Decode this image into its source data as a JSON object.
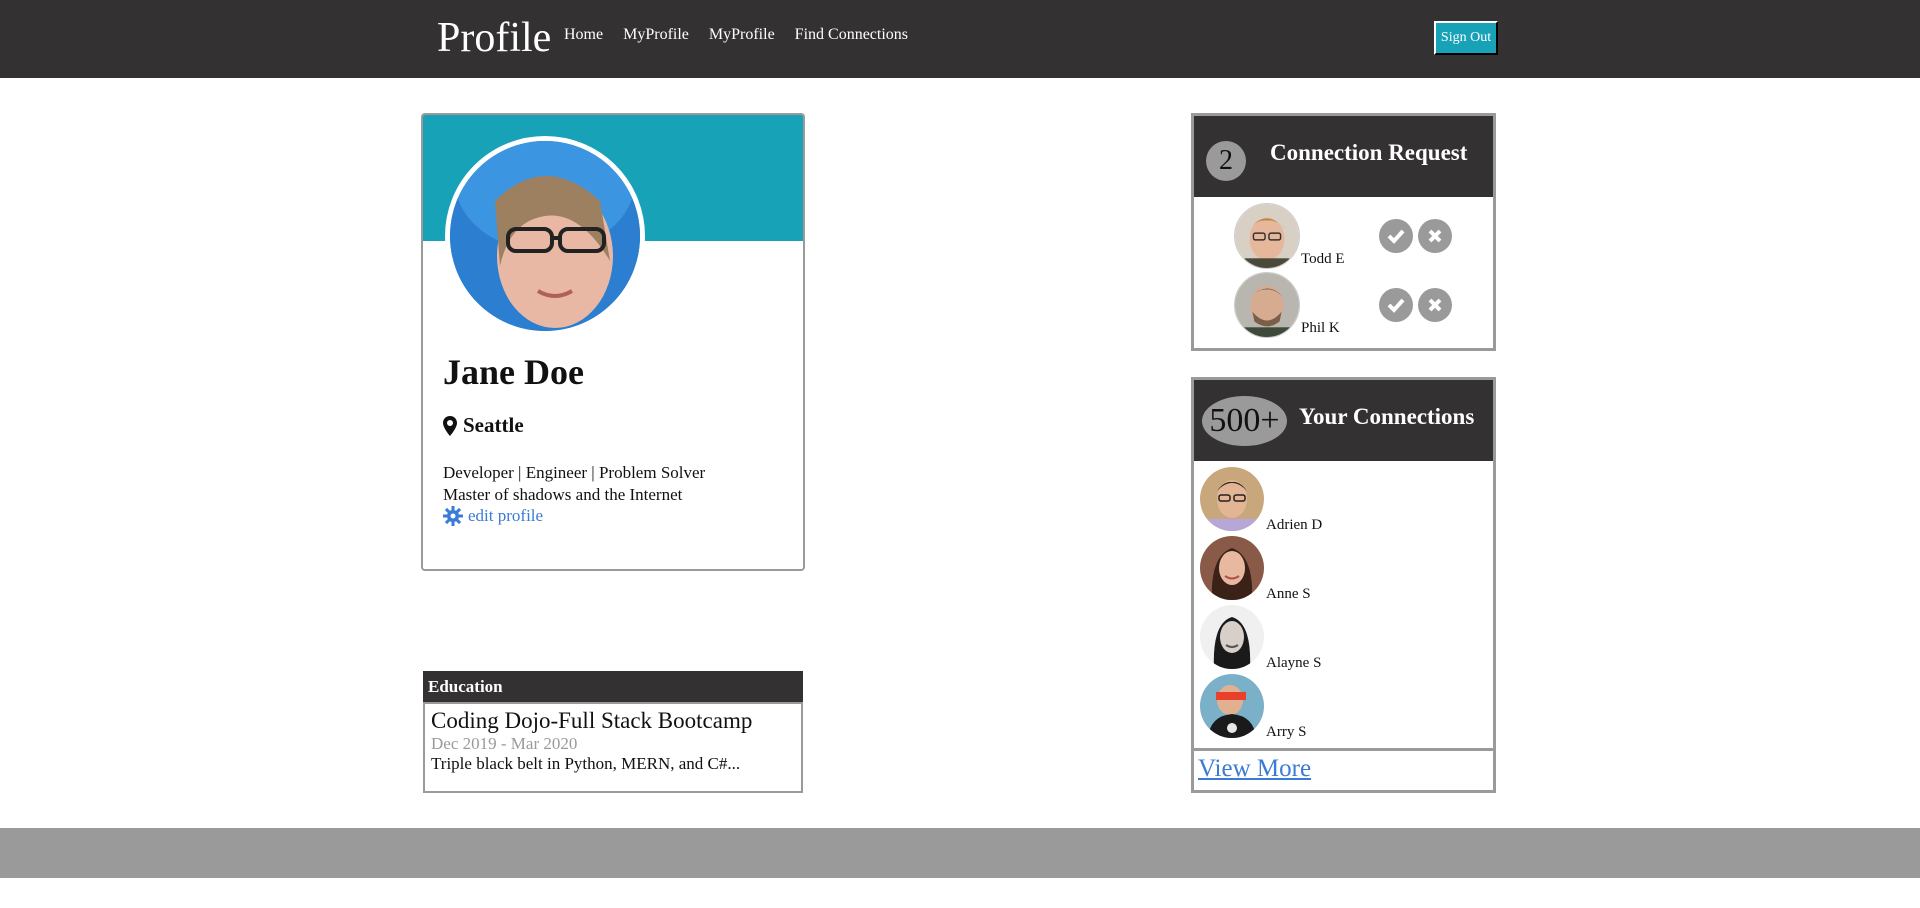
{
  "header": {
    "brand": "Profile",
    "nav": [
      "Home",
      "MyProfile",
      "MyProfile",
      "Find Connections"
    ],
    "sign_out": "Sign Out"
  },
  "profile": {
    "name": "Jane Doe",
    "location": "Seattle",
    "bio_line1": "Developer | Engineer | Problem Solver",
    "bio_line2": "Master of shadows and the Internet",
    "edit_label": "edit profile",
    "banner_color": "#17a2b8"
  },
  "education": {
    "heading": "Education",
    "title": "Coding Dojo-Full Stack Bootcamp",
    "dates": "Dec 2019 - Mar 2020",
    "description": "Triple black belt in Python, MERN, and C#..."
  },
  "requests": {
    "count": "2",
    "title": "Connection Request",
    "items": [
      {
        "name": "Todd E"
      },
      {
        "name": "Phil K"
      }
    ],
    "accept_icon": "check-icon",
    "decline_icon": "close-icon"
  },
  "connections": {
    "count": "500+",
    "title": "Your Connections",
    "items": [
      {
        "name": "Adrien D"
      },
      {
        "name": "Anne S"
      },
      {
        "name": "Alayne S"
      },
      {
        "name": "Arry S"
      }
    ],
    "view_more": "View More"
  },
  "colors": {
    "header_bg": "#333132",
    "accent": "#17a2b8",
    "badge": "#9a9a9a",
    "link": "#3a7bd5"
  }
}
